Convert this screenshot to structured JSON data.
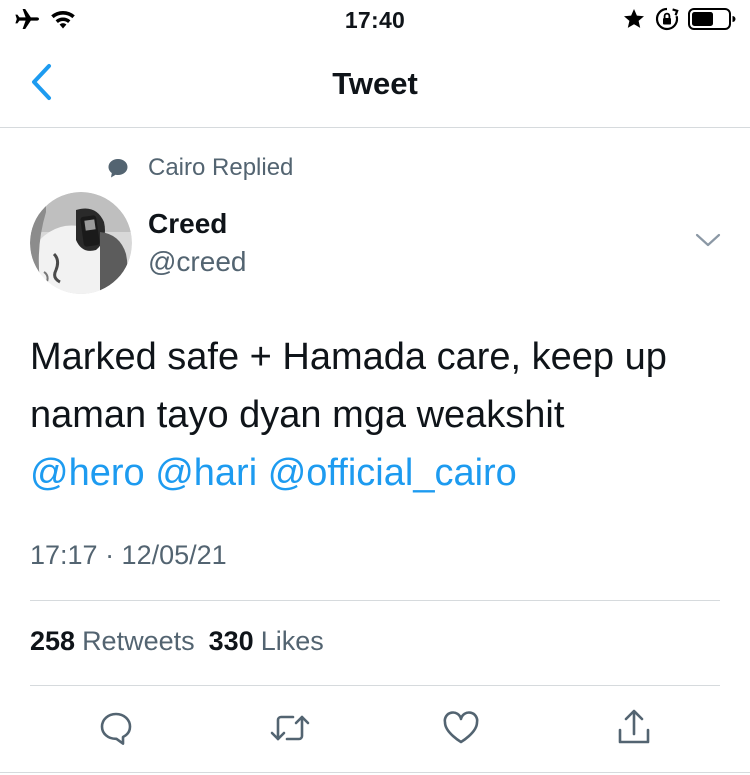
{
  "status_bar": {
    "time": "17:40",
    "left_icons": [
      "airplane-icon",
      "wifi-icon"
    ],
    "right_icons": [
      "star-icon",
      "orientation-lock-icon",
      "battery-icon"
    ]
  },
  "nav": {
    "back_icon": "chevron-left-icon",
    "title": "Tweet"
  },
  "social_context": {
    "icon": "reply-bubble-icon",
    "text": "Cairo Replied"
  },
  "author": {
    "name": "Creed",
    "handle": "@creed"
  },
  "tweet": {
    "line1": "Marked safe + Hamada care, keep up",
    "line2": "naman tayo dyan mga weakshit",
    "mentions": [
      "@hero",
      "@hari",
      "@official_cairo"
    ],
    "timestamp": "17:17 · 12/05/21"
  },
  "stats": {
    "retweets_count": "258",
    "retweets_label": "Retweets",
    "likes_count": "330",
    "likes_label": "Likes"
  },
  "actions": [
    "reply-icon",
    "retweet-icon",
    "like-icon",
    "share-icon"
  ],
  "colors": {
    "accent": "#1d9bf0",
    "text": "#0f1419",
    "secondary": "#536471",
    "divider": "#d6dadd"
  }
}
